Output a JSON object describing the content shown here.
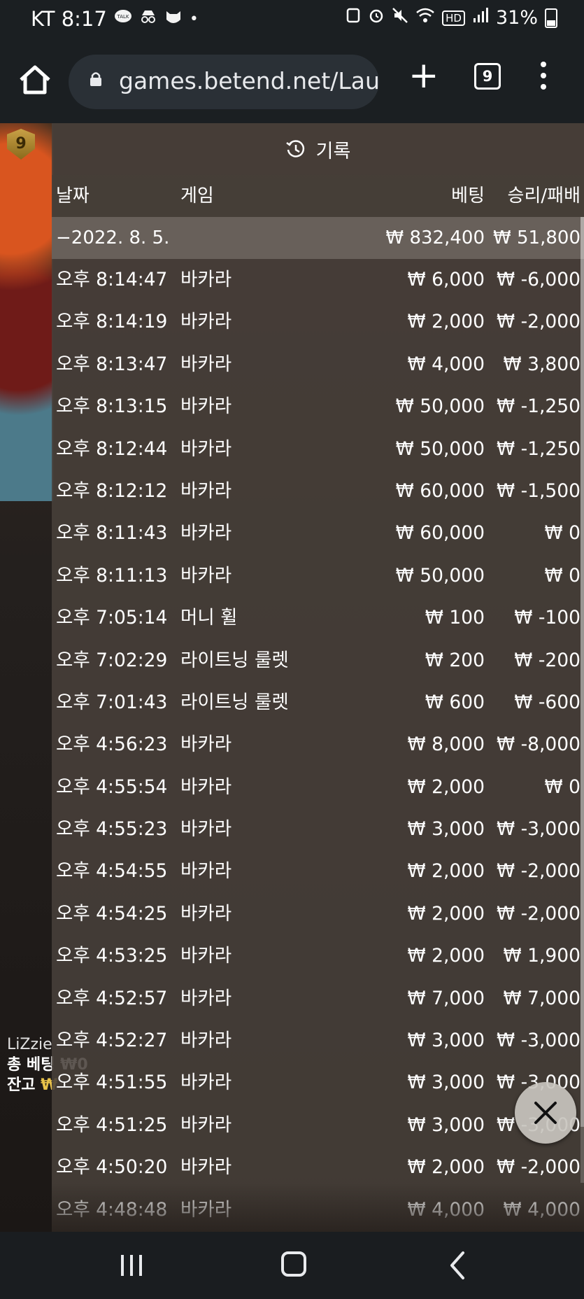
{
  "status": {
    "carrier_time": "KT 8:17",
    "icons_left": [
      "talk-icon",
      "incognito-icon",
      "cat-icon",
      "dot"
    ],
    "talk_label": "TALK",
    "right_text": "31%",
    "hd_label": "HD"
  },
  "browser": {
    "url": "games.betend.net/Lau",
    "tab_count": "9",
    "plus_label": "+"
  },
  "game": {
    "level": "9",
    "player_name": "LiZzie",
    "total_bet_label": "총 베팅",
    "total_bet_value": "₩0",
    "balance_label": "잔고",
    "balance_value": "₩"
  },
  "history": {
    "title": "기록",
    "columns": {
      "date": "날짜",
      "game": "게임",
      "bet": "베팅",
      "winloss": "승리/패배"
    },
    "summary": {
      "date": "−2022. 8. 5.",
      "bet": "₩ 832,400",
      "winloss": "₩ 51,800"
    },
    "rows": [
      {
        "time": "오후 8:14:47",
        "game": "바카라",
        "bet": "₩ 6,000",
        "result": "₩ -6,000"
      },
      {
        "time": "오후 8:14:19",
        "game": "바카라",
        "bet": "₩ 2,000",
        "result": "₩ -2,000"
      },
      {
        "time": "오후 8:13:47",
        "game": "바카라",
        "bet": "₩ 4,000",
        "result": "₩ 3,800"
      },
      {
        "time": "오후 8:13:15",
        "game": "바카라",
        "bet": "₩ 50,000",
        "result": "₩ -1,250"
      },
      {
        "time": "오후 8:12:44",
        "game": "바카라",
        "bet": "₩ 50,000",
        "result": "₩ -1,250"
      },
      {
        "time": "오후 8:12:12",
        "game": "바카라",
        "bet": "₩ 60,000",
        "result": "₩ -1,500"
      },
      {
        "time": "오후 8:11:43",
        "game": "바카라",
        "bet": "₩ 60,000",
        "result": "₩ 0"
      },
      {
        "time": "오후 8:11:13",
        "game": "바카라",
        "bet": "₩ 50,000",
        "result": "₩ 0"
      },
      {
        "time": "오후 7:05:14",
        "game": "머니 휠",
        "bet": "₩ 100",
        "result": "₩ -100"
      },
      {
        "time": "오후 7:02:29",
        "game": "라이트닝 룰렛",
        "bet": "₩ 200",
        "result": "₩ -200"
      },
      {
        "time": "오후 7:01:43",
        "game": "라이트닝 룰렛",
        "bet": "₩ 600",
        "result": "₩ -600"
      },
      {
        "time": "오후 4:56:23",
        "game": "바카라",
        "bet": "₩ 8,000",
        "result": "₩ -8,000"
      },
      {
        "time": "오후 4:55:54",
        "game": "바카라",
        "bet": "₩ 2,000",
        "result": "₩ 0"
      },
      {
        "time": "오후 4:55:23",
        "game": "바카라",
        "bet": "₩ 3,000",
        "result": "₩ -3,000"
      },
      {
        "time": "오후 4:54:55",
        "game": "바카라",
        "bet": "₩ 2,000",
        "result": "₩ -2,000"
      },
      {
        "time": "오후 4:54:25",
        "game": "바카라",
        "bet": "₩ 2,000",
        "result": "₩ -2,000"
      },
      {
        "time": "오후 4:53:25",
        "game": "바카라",
        "bet": "₩ 2,000",
        "result": "₩ 1,900"
      },
      {
        "time": "오후 4:52:57",
        "game": "바카라",
        "bet": "₩ 7,000",
        "result": "₩ 7,000"
      },
      {
        "time": "오후 4:52:27",
        "game": "바카라",
        "bet": "₩ 3,000",
        "result": "₩ -3,000"
      },
      {
        "time": "오후 4:51:55",
        "game": "바카라",
        "bet": "₩ 3,000",
        "result": "₩ -3,000"
      },
      {
        "time": "오후 4:51:25",
        "game": "바카라",
        "bet": "₩ 3,000",
        "result": "₩ -3,000"
      },
      {
        "time": "오후 4:50:20",
        "game": "바카라",
        "bet": "₩ 2,000",
        "result": "₩ -2,000"
      },
      {
        "time": "오후 4:48:48",
        "game": "바카라",
        "bet": "₩ 4,000",
        "result": "₩ 4,000"
      }
    ]
  },
  "colors": {
    "panel": "#48403a",
    "summary": "#6e6660",
    "text": "#ffffff"
  }
}
